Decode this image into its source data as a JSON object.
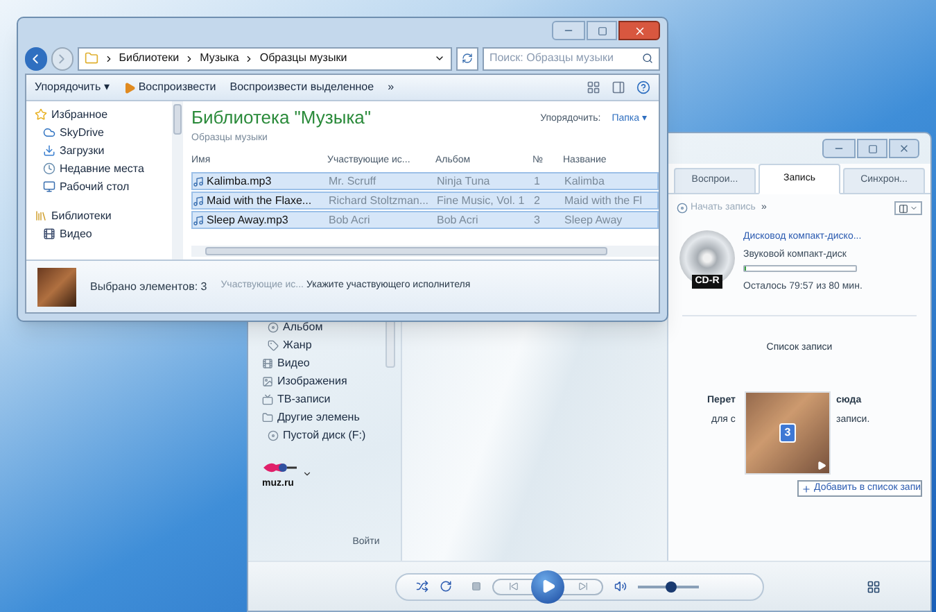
{
  "explorer": {
    "breadcrumb": [
      "Библиотеки",
      "Музыка",
      "Образцы музыки"
    ],
    "search": {
      "placeholder": "Поиск: Образцы музыки"
    },
    "toolbar": [
      "Упорядочить ▾",
      "Воспроизвести",
      "Воспроизвести выделенное",
      "»"
    ],
    "nav_items": [
      {
        "label": "Избранное",
        "kind": "group"
      },
      {
        "label": "SkyDrive",
        "kind": "item"
      },
      {
        "label": "Загрузки",
        "kind": "item"
      },
      {
        "label": "Недавние места",
        "kind": "item"
      },
      {
        "label": "Рабочий стол",
        "kind": "item"
      },
      {
        "label": "Библиотеки",
        "kind": "group"
      },
      {
        "label": "Видео",
        "kind": "item"
      }
    ],
    "library_title": "Библиотека \"Музыка\"",
    "library_subtitle": "Образцы музыки",
    "arrange_label": "Упорядочить:",
    "arrange_value": "Папка ▾",
    "columns": [
      "Имя",
      "Участвующие ис...",
      "Альбом",
      "№",
      "Название"
    ],
    "rows": [
      {
        "cells": [
          "Kalimba.mp3",
          "Mr. Scruff",
          "Ninja Tuna",
          "1",
          "Kalimba"
        ],
        "selected": true
      },
      {
        "cells": [
          "Maid with the Flaxe...",
          "Richard Stoltzman...",
          "Fine Music, Vol. 1",
          "2",
          "Maid with the Fl"
        ],
        "selected": true
      },
      {
        "cells": [
          "Sleep Away.mp3",
          "Bob Acri",
          "Bob Acri",
          "3",
          "Sleep Away"
        ],
        "selected": true
      }
    ],
    "details": {
      "count": "Выбрано элементов: 3",
      "field_label": "Участвующие ис...",
      "field_value": "Укажите участвующего исполнителя"
    }
  },
  "player": {
    "nav_items": [
      "Альбом",
      "Жанр",
      "Видео",
      "Изображения",
      "ТВ-записи",
      "Другие элемень",
      "Пустой диск (F:)"
    ],
    "logo_text": "muz.ru",
    "sign_in": "Войти",
    "tabs": [
      {
        "label": "Воспрои...",
        "selected": false
      },
      {
        "label": "Запись",
        "selected": true
      },
      {
        "label": "Синхрон...",
        "selected": false
      }
    ],
    "start_burn": "Начать запись",
    "more": "»",
    "drive": {
      "name": "Дисковод компакт-диско...",
      "type": "Звуковой компакт-диск",
      "level": 0.01,
      "remaining": "Осталось 79:57 из 80 мин.",
      "disc_label": "CD-R"
    },
    "burn_list_title": "Список записи",
    "hint_fragments": [
      "Перет",
      "сюда",
      "для с",
      "записи."
    ],
    "drag": {
      "count": "3",
      "tooltip": "Добавить в список запи"
    },
    "volume": {
      "level": 0.55
    }
  }
}
